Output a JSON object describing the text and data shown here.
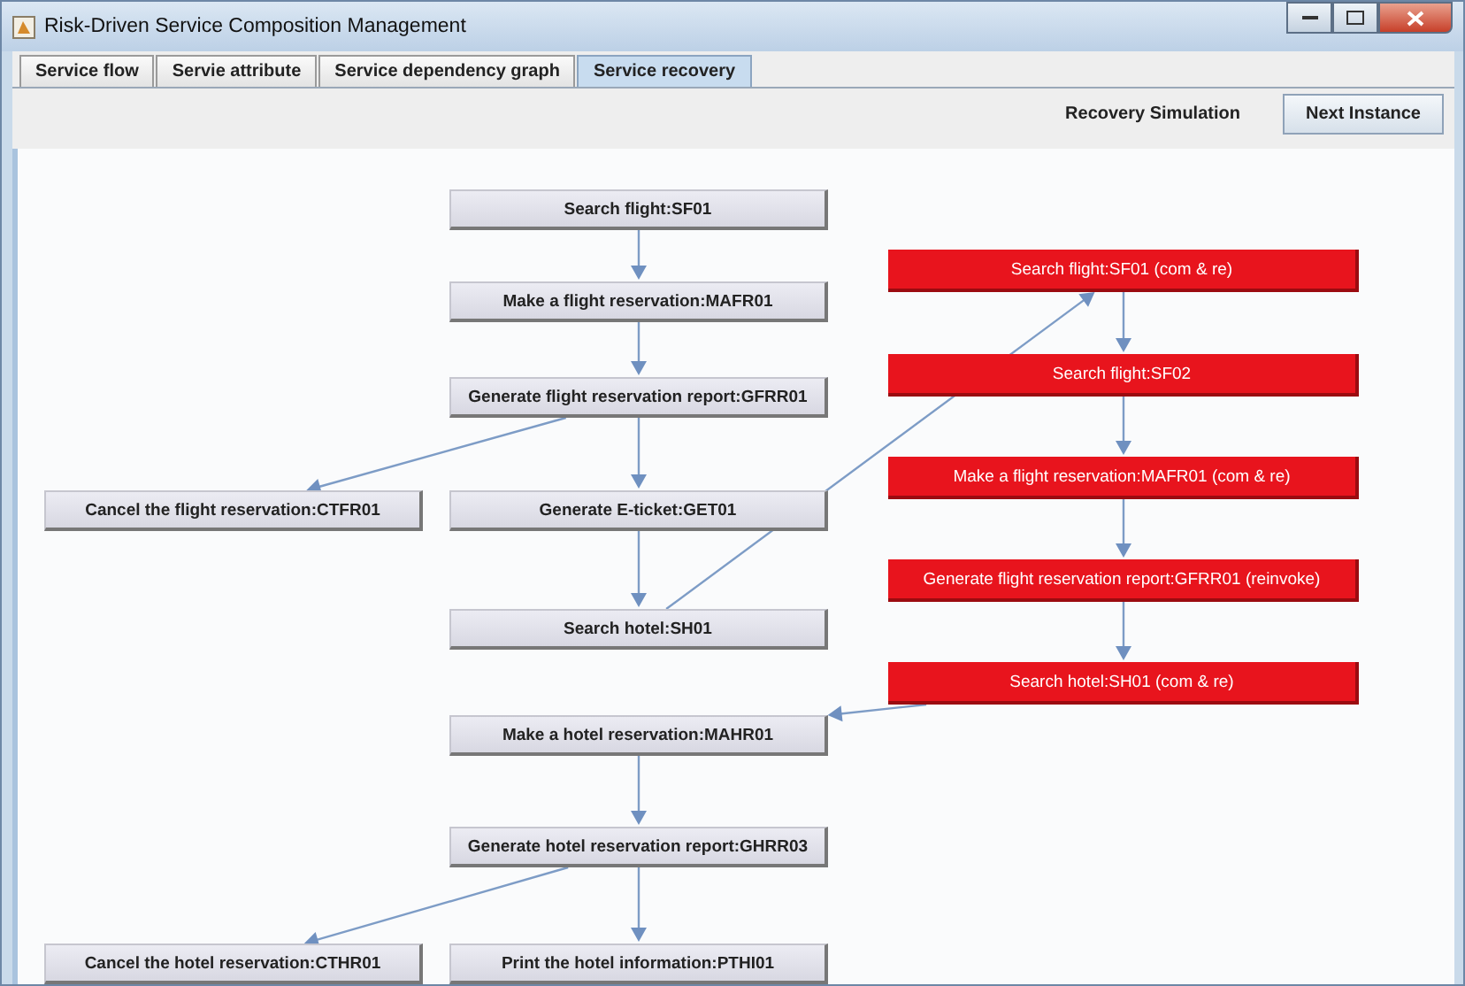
{
  "window": {
    "title": "Risk-Driven Service Composition Management"
  },
  "tabs": [
    {
      "label": "Service flow",
      "selected": false
    },
    {
      "label": "Servie attribute",
      "selected": false
    },
    {
      "label": "Service dependency graph",
      "selected": false
    },
    {
      "label": "Service recovery",
      "selected": true
    }
  ],
  "toolbar": {
    "label": "Recovery Simulation",
    "button": "Next Instance"
  },
  "graph": {
    "nodes": [
      {
        "label": "Search flight:SF01",
        "kind": "service"
      },
      {
        "label": "Make a flight reservation:MAFR01",
        "kind": "service"
      },
      {
        "label": "Generate flight reservation report:GFRR01",
        "kind": "service"
      },
      {
        "label": "Cancel the flight reservation:CTFR01",
        "kind": "service"
      },
      {
        "label": "Generate E-ticket:GET01",
        "kind": "service"
      },
      {
        "label": "Search hotel:SH01",
        "kind": "service"
      },
      {
        "label": "Make a hotel reservation:MAHR01",
        "kind": "service"
      },
      {
        "label": "Generate hotel reservation report:GHRR03",
        "kind": "service"
      },
      {
        "label": "Cancel the hotel reservation:CTHR01",
        "kind": "service"
      },
      {
        "label": "Print the hotel information:PTHI01",
        "kind": "service"
      },
      {
        "label": "Search flight:SF01 (com & re)",
        "kind": "recovery"
      },
      {
        "label": "Search flight:SF02",
        "kind": "recovery"
      },
      {
        "label": "Make a flight reservation:MAFR01 (com & re)",
        "kind": "recovery"
      },
      {
        "label": "Generate flight reservation report:GFRR01 (reinvoke)",
        "kind": "recovery"
      },
      {
        "label": "Search hotel:SH01 (com & re)",
        "kind": "recovery"
      }
    ]
  }
}
